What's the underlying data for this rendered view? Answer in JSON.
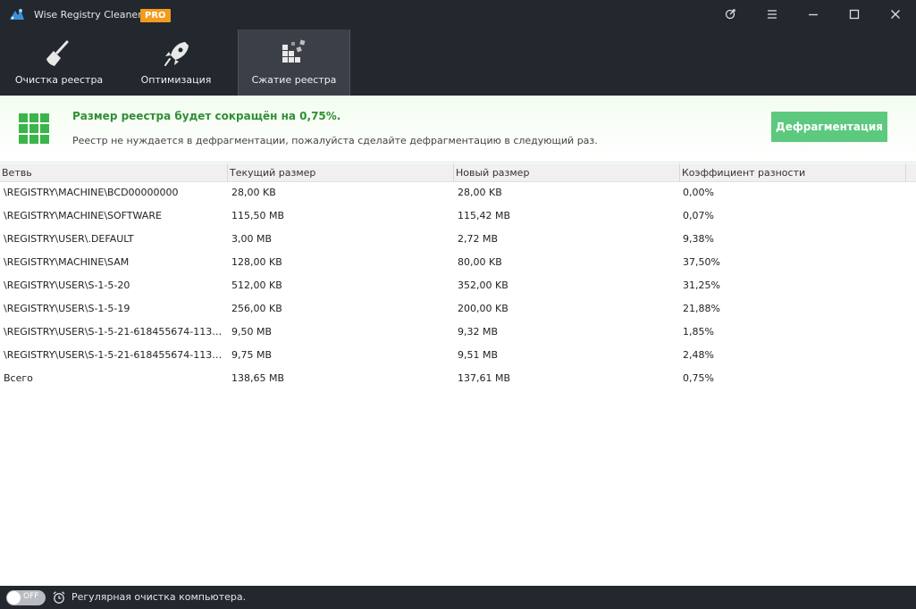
{
  "window": {
    "title": "Wise Registry Cleaner X",
    "badge": "PRO",
    "controls": [
      "restore-theme-icon",
      "menu-icon",
      "minimize-icon",
      "maximize-icon",
      "close-icon"
    ]
  },
  "nav": {
    "tabs": [
      {
        "label": "Очистка реестра",
        "icon": "broom-icon"
      },
      {
        "label": "Оптимизация",
        "icon": "rocket-icon"
      },
      {
        "label": "Сжатие реестра",
        "icon": "blocks-icon",
        "active": true
      }
    ]
  },
  "banner": {
    "title": "Размер реестра будет сокращён на 0,75%.",
    "subtitle": "Реестр не нуждается в дефрагментации, пожалуйста сделайте дефрагментацию в следующий раз.",
    "button": "Дефрагментация"
  },
  "table": {
    "columns": [
      "Ветвь",
      "Текущий размер",
      "Новый размер",
      "Коэффициент разности"
    ],
    "rows": [
      [
        "\\REGISTRY\\MACHINE\\BCD00000000",
        "28,00 KB",
        "28,00 KB",
        "0,00%"
      ],
      [
        "\\REGISTRY\\MACHINE\\SOFTWARE",
        "115,50 MB",
        "115,42 MB",
        "0,07%"
      ],
      [
        "\\REGISTRY\\USER\\.DEFAULT",
        "3,00 MB",
        "2,72 MB",
        "9,38%"
      ],
      [
        "\\REGISTRY\\MACHINE\\SAM",
        "128,00 KB",
        "80,00 KB",
        "37,50%"
      ],
      [
        "\\REGISTRY\\USER\\S-1-5-20",
        "512,00 KB",
        "352,00 KB",
        "31,25%"
      ],
      [
        "\\REGISTRY\\USER\\S-1-5-19",
        "256,00 KB",
        "200,00 KB",
        "21,88%"
      ],
      [
        "\\REGISTRY\\USER\\S-1-5-21-618455674-1134261...",
        "9,50 MB",
        "9,32 MB",
        "1,85%"
      ],
      [
        "\\REGISTRY\\USER\\S-1-5-21-618455674-1134261...",
        "9,75 MB",
        "9,51 MB",
        "2,48%"
      ],
      [
        "Всего",
        "138,65 MB",
        "137,61 MB",
        "0,75%"
      ]
    ]
  },
  "footer": {
    "toggle": "OFF",
    "text": "Регулярная очистка компьютера."
  },
  "colors": {
    "dark": "#23272e",
    "accent_green": "#3bb54a",
    "button_green": "#5cc97e",
    "badge_orange": "#f29b1d"
  }
}
